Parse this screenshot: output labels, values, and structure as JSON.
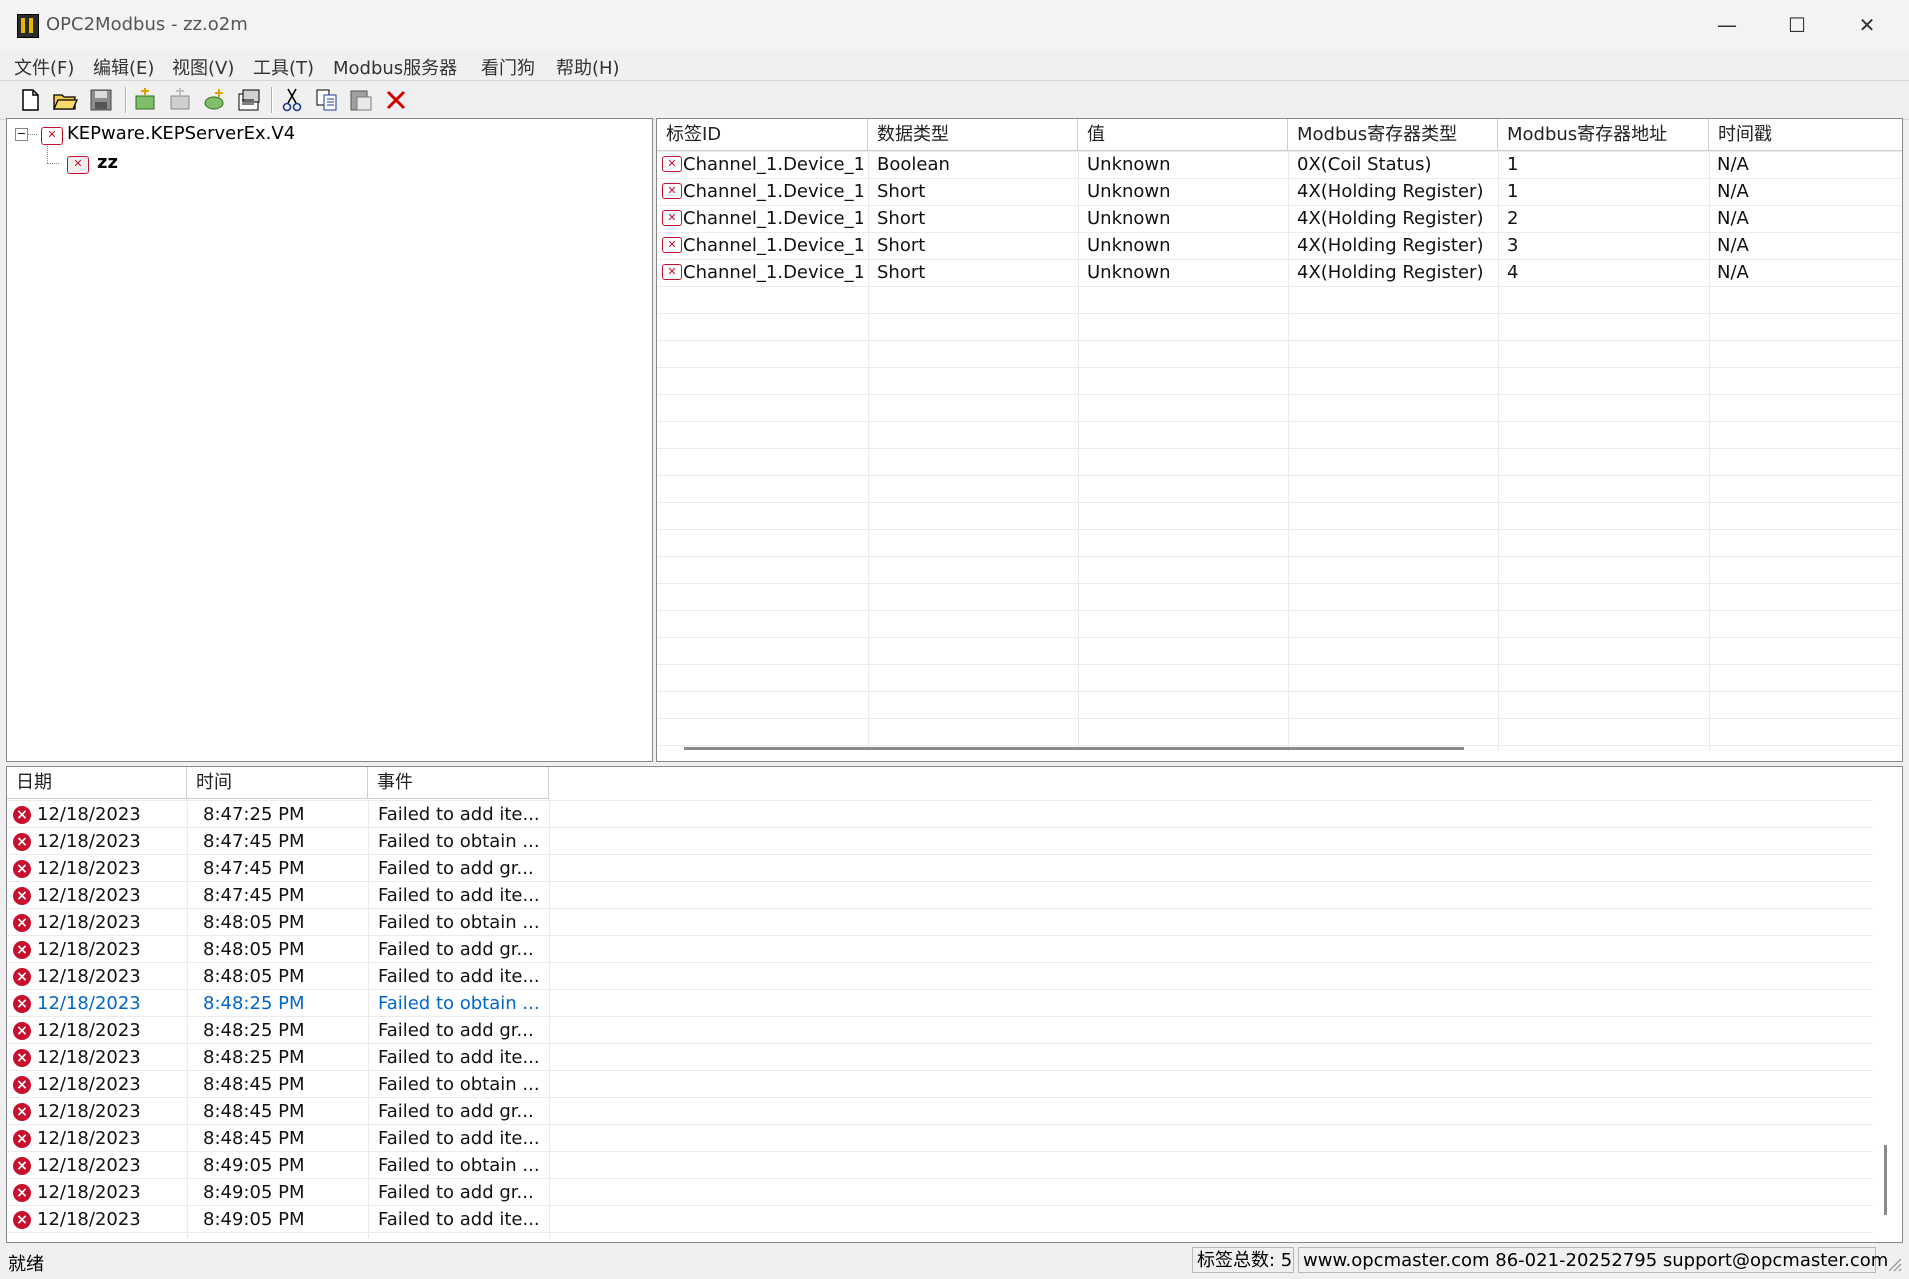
{
  "window": {
    "title": "OPC2Modbus - zz.o2m"
  },
  "menu": [
    "文件(F)",
    "编辑(E)",
    "视图(V)",
    "工具(T)",
    "Modbus服务器",
    "看门狗",
    "帮助(H)"
  ],
  "toolbar": [
    "new-file-icon",
    "open-folder-icon",
    "save-icon",
    "add-server-icon",
    "add-group-icon",
    "add-tag-icon",
    "properties-icon",
    "cut-icon",
    "copy-icon",
    "paste-icon",
    "delete-icon"
  ],
  "tree": {
    "server": "KEPware.KEPServerEx.V4",
    "group": "zz"
  },
  "tag_table": {
    "columns": [
      "标签ID",
      "数据类型",
      "值",
      "Modbus寄存器类型",
      "Modbus寄存器地址",
      "时间戳"
    ],
    "rows": [
      [
        "Channel_1.Device_1...",
        "Boolean",
        "Unknown",
        "0X(Coil Status)",
        "1",
        "N/A"
      ],
      [
        "Channel_1.Device_1...",
        "Short",
        "Unknown",
        "4X(Holding Register)",
        "1",
        "N/A"
      ],
      [
        "Channel_1.Device_1...",
        "Short",
        "Unknown",
        "4X(Holding Register)",
        "2",
        "N/A"
      ],
      [
        "Channel_1.Device_1...",
        "Short",
        "Unknown",
        "4X(Holding Register)",
        "3",
        "N/A"
      ],
      [
        "Channel_1.Device_1...",
        "Short",
        "Unknown",
        "4X(Holding Register)",
        "4",
        "N/A"
      ]
    ]
  },
  "log_table": {
    "columns": [
      "日期",
      "时间",
      "事件"
    ],
    "selected_index": 7,
    "selected_color": "#0066cc",
    "rows": [
      [
        "12/18/2023",
        "8:47:25 PM",
        "Failed to add ite..."
      ],
      [
        "12/18/2023",
        "8:47:45 PM",
        "Failed to obtain ..."
      ],
      [
        "12/18/2023",
        "8:47:45 PM",
        "Failed to add gr..."
      ],
      [
        "12/18/2023",
        "8:47:45 PM",
        "Failed to add ite..."
      ],
      [
        "12/18/2023",
        "8:48:05 PM",
        "Failed to obtain ..."
      ],
      [
        "12/18/2023",
        "8:48:05 PM",
        "Failed to add gr..."
      ],
      [
        "12/18/2023",
        "8:48:05 PM",
        "Failed to add ite..."
      ],
      [
        "12/18/2023",
        "8:48:25 PM",
        "Failed to obtain ..."
      ],
      [
        "12/18/2023",
        "8:48:25 PM",
        "Failed to add gr..."
      ],
      [
        "12/18/2023",
        "8:48:25 PM",
        "Failed to add ite..."
      ],
      [
        "12/18/2023",
        "8:48:45 PM",
        "Failed to obtain ..."
      ],
      [
        "12/18/2023",
        "8:48:45 PM",
        "Failed to add gr..."
      ],
      [
        "12/18/2023",
        "8:48:45 PM",
        "Failed to add ite..."
      ],
      [
        "12/18/2023",
        "8:49:05 PM",
        "Failed to obtain ..."
      ],
      [
        "12/18/2023",
        "8:49:05 PM",
        "Failed to add gr..."
      ],
      [
        "12/18/2023",
        "8:49:05 PM",
        "Failed to add ite..."
      ]
    ]
  },
  "status": {
    "ready": "就绪",
    "tag_count": "标签总数: 5",
    "contact": "www.opcmaster.com 86-021-20252795 support@opcmaster.com"
  }
}
